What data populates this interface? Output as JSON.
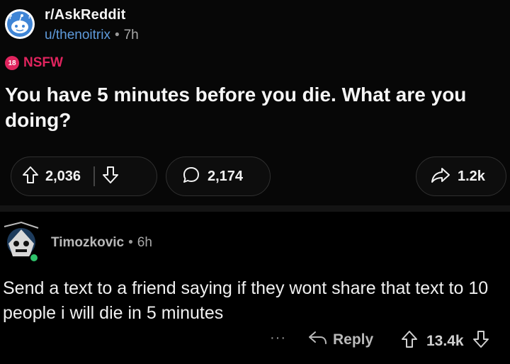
{
  "post": {
    "subreddit": "r/AskReddit",
    "author": "u/thenoitrix",
    "age": "7h",
    "nsfw_badge": "18",
    "nsfw_label": "NSFW",
    "title": "You have 5 minutes before you die. What are you doing?",
    "upvotes": "2,036",
    "comments": "2,174",
    "shares": "1.2k"
  },
  "comment": {
    "author": "Timozkovic",
    "age": "6h",
    "body": "Send a text to a friend saying if they wont share that text to 10 people i will die in 5 minutes",
    "more": "···",
    "reply_label": "Reply",
    "votes": "13.4k"
  },
  "colors": {
    "background": "#000000",
    "username": "#5f9bdc",
    "nsfw": "#e0245e",
    "online": "#2ec26b"
  },
  "icons": [
    "askreddit-logo-icon",
    "upvote-icon",
    "downvote-icon",
    "comment-bubble-icon",
    "share-icon",
    "reply-arrow-icon",
    "user-avatar-icon"
  ]
}
